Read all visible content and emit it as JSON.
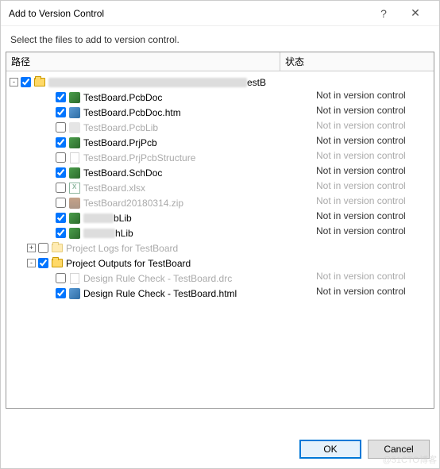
{
  "window": {
    "title": "Add to Version Control",
    "help": "?",
    "close": "✕"
  },
  "instruction": "Select the files to add to version control.",
  "columns": {
    "path": "路径",
    "state": "状态"
  },
  "status": {
    "notInVC": "Not in version control"
  },
  "tree": {
    "rootSuffix": "estB",
    "items": [
      {
        "label": "TestBoard.PcbDoc",
        "checked": true,
        "dim": false,
        "icon": "green",
        "status": "notInVC",
        "indent": 2
      },
      {
        "label": "TestBoard.PcbDoc.htm",
        "checked": true,
        "dim": false,
        "icon": "blue",
        "status": "notInVC",
        "indent": 2
      },
      {
        "label": "TestBoard.PcbLib",
        "checked": false,
        "dim": true,
        "icon": "gray",
        "status": "notInVC",
        "indent": 2
      },
      {
        "label": "TestBoard.PrjPcb",
        "checked": true,
        "dim": false,
        "icon": "green",
        "status": "notInVC",
        "indent": 2
      },
      {
        "label": "TestBoard.PrjPcbStructure",
        "checked": false,
        "dim": true,
        "icon": "file",
        "status": "notInVC",
        "indent": 2
      },
      {
        "label": "TestBoard.SchDoc",
        "checked": true,
        "dim": false,
        "icon": "green",
        "status": "notInVC",
        "indent": 2
      },
      {
        "label": "TestBoard.xlsx",
        "checked": false,
        "dim": true,
        "icon": "xls",
        "status": "notInVC",
        "indent": 2
      },
      {
        "label": "TestBoard20180314.zip",
        "checked": false,
        "dim": true,
        "icon": "zip",
        "status": "notInVC",
        "indent": 2
      },
      {
        "label": "bLib",
        "checked": true,
        "dim": false,
        "icon": "green",
        "status": "notInVC",
        "indent": 2,
        "smudge": 38
      },
      {
        "label": "hLib",
        "checked": true,
        "dim": false,
        "icon": "green",
        "status": "notInVC",
        "indent": 2,
        "smudge": 40
      },
      {
        "label": "Project Logs for TestBoard",
        "checked": false,
        "dim": true,
        "icon": "folder",
        "status": "",
        "indent": 1,
        "toggle": "+"
      },
      {
        "label": "Project Outputs for TestBoard",
        "checked": true,
        "dim": false,
        "icon": "folder",
        "status": "",
        "indent": 1,
        "toggle": "-"
      },
      {
        "label": "Design Rule Check - TestBoard.drc",
        "checked": false,
        "dim": true,
        "icon": "file",
        "status": "notInVC",
        "indent": 2
      },
      {
        "label": "Design Rule Check - TestBoard.html",
        "checked": true,
        "dim": false,
        "icon": "blue",
        "status": "notInVC",
        "indent": 2
      }
    ]
  },
  "buttons": {
    "ok": "OK",
    "cancel": "Cancel"
  },
  "watermark": "@51CTO博客"
}
